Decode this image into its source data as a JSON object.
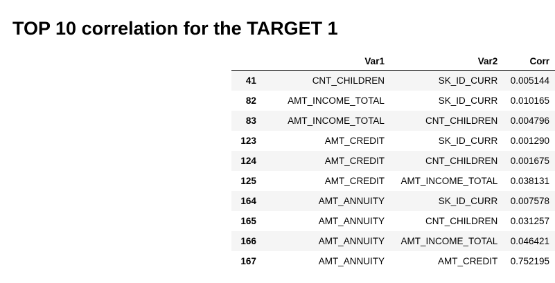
{
  "page": {
    "title": "TOP 10 correlation for the TARGET 1"
  },
  "table": {
    "columns": [
      "",
      "Var1",
      "Var2",
      "Corr"
    ],
    "rows": [
      {
        "index": "41",
        "var1": "CNT_CHILDREN",
        "var2": "SK_ID_CURR",
        "corr": "0.005144"
      },
      {
        "index": "82",
        "var1": "AMT_INCOME_TOTAL",
        "var2": "SK_ID_CURR",
        "corr": "0.010165"
      },
      {
        "index": "83",
        "var1": "AMT_INCOME_TOTAL",
        "var2": "CNT_CHILDREN",
        "corr": "0.004796"
      },
      {
        "index": "123",
        "var1": "AMT_CREDIT",
        "var2": "SK_ID_CURR",
        "corr": "0.001290"
      },
      {
        "index": "124",
        "var1": "AMT_CREDIT",
        "var2": "CNT_CHILDREN",
        "corr": "0.001675"
      },
      {
        "index": "125",
        "var1": "AMT_CREDIT",
        "var2": "AMT_INCOME_TOTAL",
        "corr": "0.038131"
      },
      {
        "index": "164",
        "var1": "AMT_ANNUITY",
        "var2": "SK_ID_CURR",
        "corr": "0.007578"
      },
      {
        "index": "165",
        "var1": "AMT_ANNUITY",
        "var2": "CNT_CHILDREN",
        "corr": "0.031257"
      },
      {
        "index": "166",
        "var1": "AMT_ANNUITY",
        "var2": "AMT_INCOME_TOTAL",
        "corr": "0.046421"
      },
      {
        "index": "167",
        "var1": "AMT_ANNUITY",
        "var2": "AMT_CREDIT",
        "corr": "0.752195"
      }
    ]
  },
  "colors": {
    "stripe": "#f5f5f5",
    "header_rule": "#000000"
  }
}
